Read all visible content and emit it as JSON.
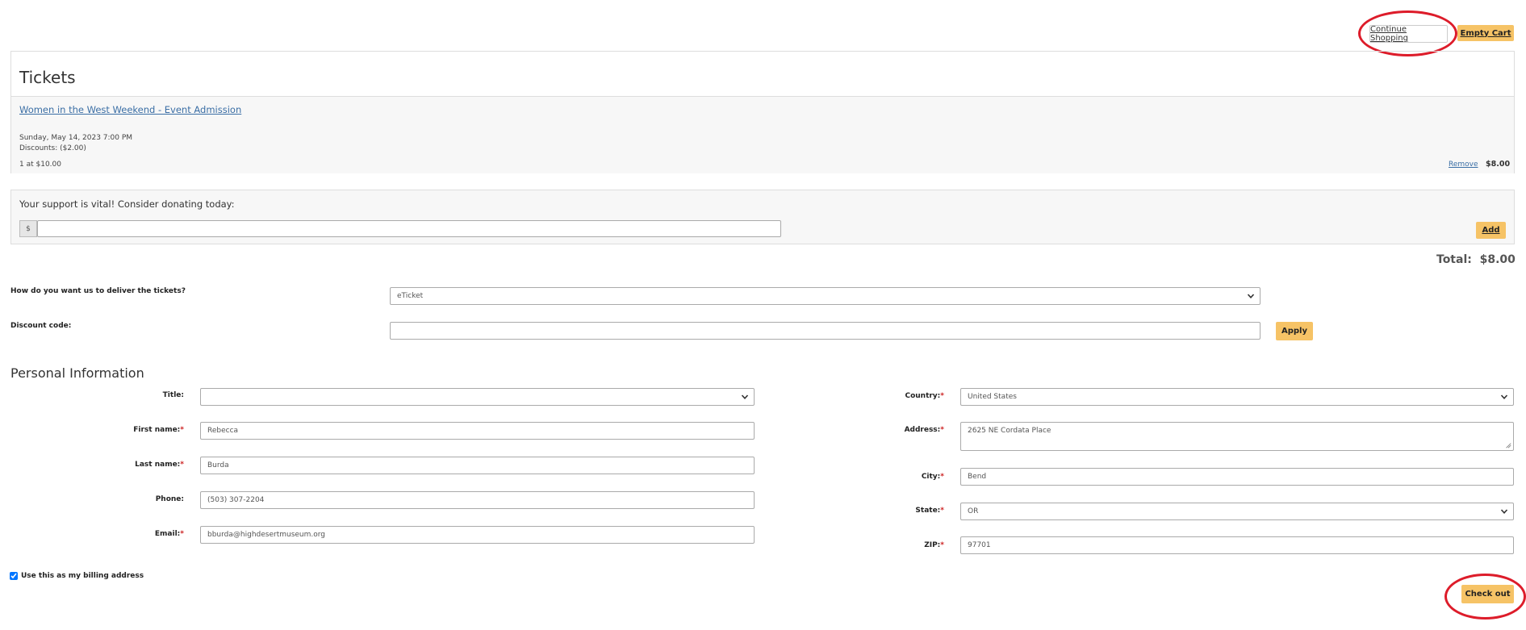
{
  "header": {
    "continue_shopping": "Continue Shopping",
    "empty_cart": "Empty Cart"
  },
  "tickets": {
    "heading": "Tickets",
    "item": {
      "title": "Women in the West Weekend - Event Admission",
      "date": "Sunday, May 14, 2023 7:00 PM",
      "discounts": "Discounts: ($2.00)",
      "qty_price": "1 at $10.00",
      "remove": "Remove",
      "line_total": "$8.00"
    }
  },
  "donation": {
    "prompt": "Your support is vital! Consider donating today:",
    "currency": "$",
    "amount": "",
    "add": "Add"
  },
  "total": {
    "label": "Total:",
    "value": "$8.00"
  },
  "delivery": {
    "label": "How do you want us to deliver the tickets?",
    "selected": "eTicket"
  },
  "discount": {
    "label": "Discount code:",
    "value": "",
    "apply": "Apply"
  },
  "personal": {
    "heading": "Personal Information",
    "title_label": "Title:",
    "title_value": "",
    "first_label": "First name:",
    "first_value": "Rebecca",
    "last_label": "Last name:",
    "last_value": "Burda",
    "phone_label": "Phone:",
    "phone_value": "(503) 307-2204",
    "email_label": "Email:",
    "email_value": "bburda@highdesertmuseum.org",
    "country_label": "Country:",
    "country_value": "United States",
    "address_label": "Address:",
    "address_value": "2625 NE Cordata Place",
    "city_label": "City:",
    "city_value": "Bend",
    "state_label": "State:",
    "state_value": "OR",
    "zip_label": "ZIP:",
    "zip_value": "97701",
    "required_mark": "*"
  },
  "billing": {
    "label": "Use this as my billing address",
    "checked": true
  },
  "checkout": {
    "label": "Check out"
  },
  "colors": {
    "accent": "#f6c366",
    "annotation": "#dd1c2a",
    "link": "#3a6ea5"
  }
}
